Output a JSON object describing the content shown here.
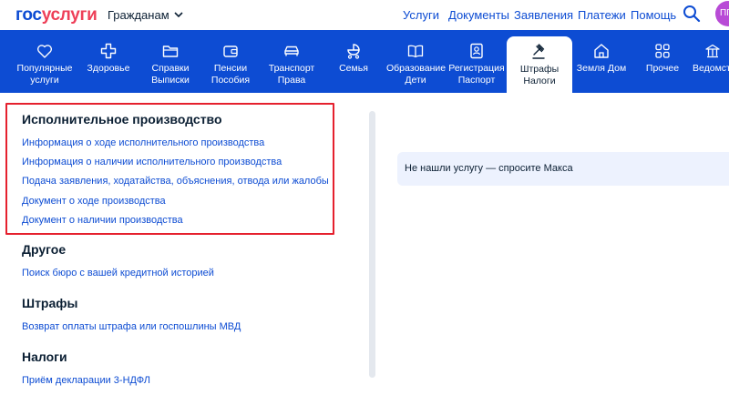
{
  "header": {
    "logo_part1": "гос",
    "logo_part2": "услуги",
    "citizens_menu": "Гражданам",
    "nav": [
      "Услуги",
      "Документы",
      "Заявления",
      "Платежи",
      "Помощь"
    ],
    "avatar_initials": "ПГ"
  },
  "categories": [
    {
      "line1": "Популярные",
      "line2": "услуги",
      "icon": "heart-icon"
    },
    {
      "line1": "Здоровье",
      "line2": "",
      "icon": "cross-icon"
    },
    {
      "line1": "Справки",
      "line2": "Выписки",
      "icon": "folder-icon"
    },
    {
      "line1": "Пенсии",
      "line2": "Пособия",
      "icon": "wallet-icon"
    },
    {
      "line1": "Транспорт",
      "line2": "Права",
      "icon": "car-icon"
    },
    {
      "line1": "Семья",
      "line2": "",
      "icon": "stroller-icon"
    },
    {
      "line1": "Образование",
      "line2": "Дети",
      "icon": "book-icon"
    },
    {
      "line1": "Регистрация",
      "line2": "Паспорт",
      "icon": "id-card-icon"
    },
    {
      "line1": "Штрафы",
      "line2": "Налоги",
      "icon": "gavel-icon",
      "active": true
    },
    {
      "line1": "Земля Дом",
      "line2": "",
      "icon": "house-icon"
    },
    {
      "line1": "Прочее",
      "line2": "",
      "icon": "grid-icon"
    },
    {
      "line1": "Ведомст",
      "line2": "",
      "icon": "building-icon"
    }
  ],
  "sections": [
    {
      "title": "Исполнительное производство",
      "links": [
        "Информация о ходе исполнительного производства",
        "Информация о наличии исполнительного производства",
        "Подача заявления, ходатайства, объяснения, отвода или жалобы",
        "Документ о ходе производства",
        "Документ о наличии производства"
      ]
    },
    {
      "title": "Другое",
      "links": [
        "Поиск бюро с вашей кредитной историей"
      ]
    },
    {
      "title": "Штрафы",
      "links": [
        "Возврат оплаты штрафа или госпошлины МВД"
      ]
    },
    {
      "title": "Налоги",
      "links": [
        "Приём декларации 3-НДФЛ"
      ]
    }
  ],
  "ask_banner": "Не нашли услугу — спросите Макса",
  "colors": {
    "brand_blue": "#0d4cd3",
    "brand_red": "#ee3f58",
    "highlight": "#e5202e",
    "banner_bg": "#edf2fe"
  }
}
